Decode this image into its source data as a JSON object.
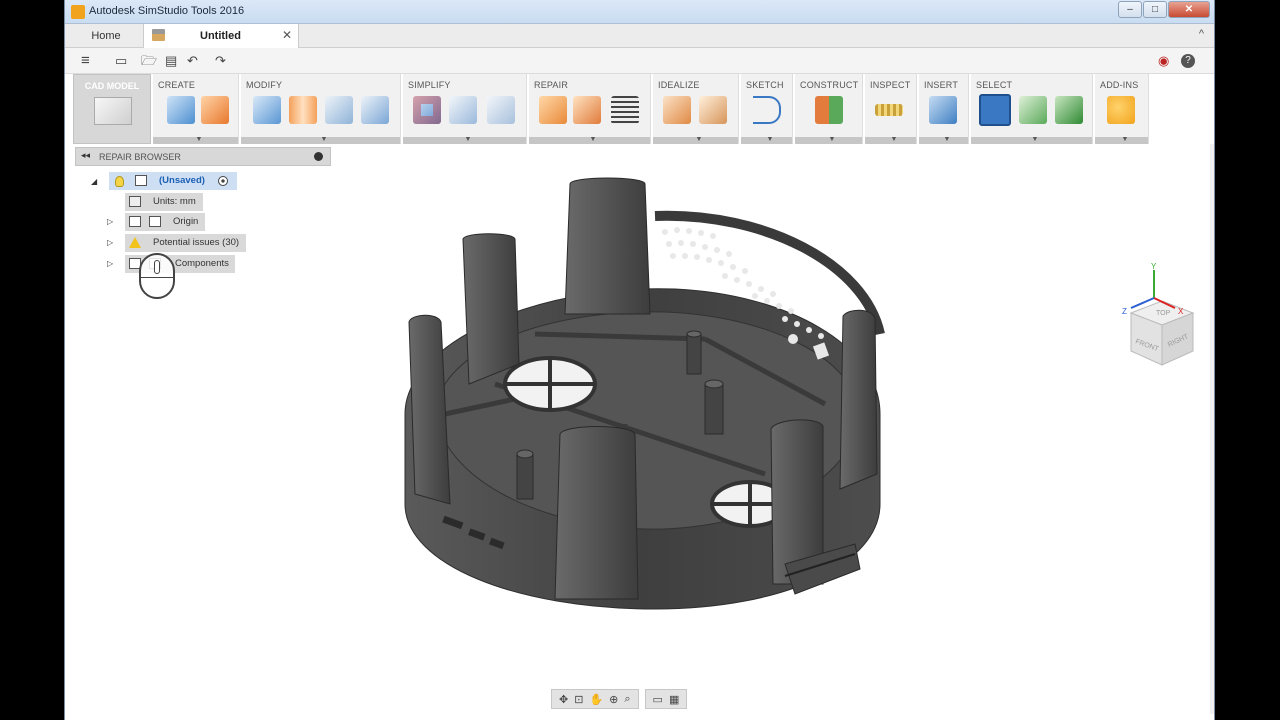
{
  "window": {
    "title": "Autodesk SimStudio Tools 2016",
    "min": "–",
    "max": "□",
    "close": "✕"
  },
  "tabs": {
    "home": "Home",
    "active": "Untitled",
    "close": "✕",
    "collapse": "^"
  },
  "quick": {
    "menu": "≡",
    "new": "▭",
    "open": "🗁",
    "save": "▤",
    "undo": "↶",
    "redo": "↷",
    "record": "◉",
    "help": "?"
  },
  "ribbon": {
    "workspace": "CAD MODEL",
    "groups": [
      "CREATE",
      "MODIFY",
      "SIMPLIFY",
      "REPAIR",
      "IDEALIZE",
      "SKETCH",
      "CONSTRUCT",
      "INSPECT",
      "INSERT",
      "SELECT",
      "ADD-INS"
    ],
    "dropdown": "▼"
  },
  "browser": {
    "title": "REPAIR BROWSER",
    "collapse": "◂◂",
    "root": "(Unsaved)",
    "units": "Units: mm",
    "origin": "Origin",
    "issues": "Potential issues (30)",
    "components": "Components"
  },
  "viewcube": {
    "top": "TOP",
    "front": "FRONT",
    "right": "RIGHT"
  },
  "axes": {
    "x": "X",
    "y": "Y",
    "z": "Z"
  },
  "colors": {
    "accent": "#1a5fb4",
    "model": "#4a4a4a",
    "addin": "#f2a31d"
  },
  "nav": {
    "orbit": "✥",
    "look": "⊡",
    "pan": "✋",
    "zoom": "⊕",
    "fit": "⌕",
    "display": "▭",
    "grid": "▦"
  }
}
